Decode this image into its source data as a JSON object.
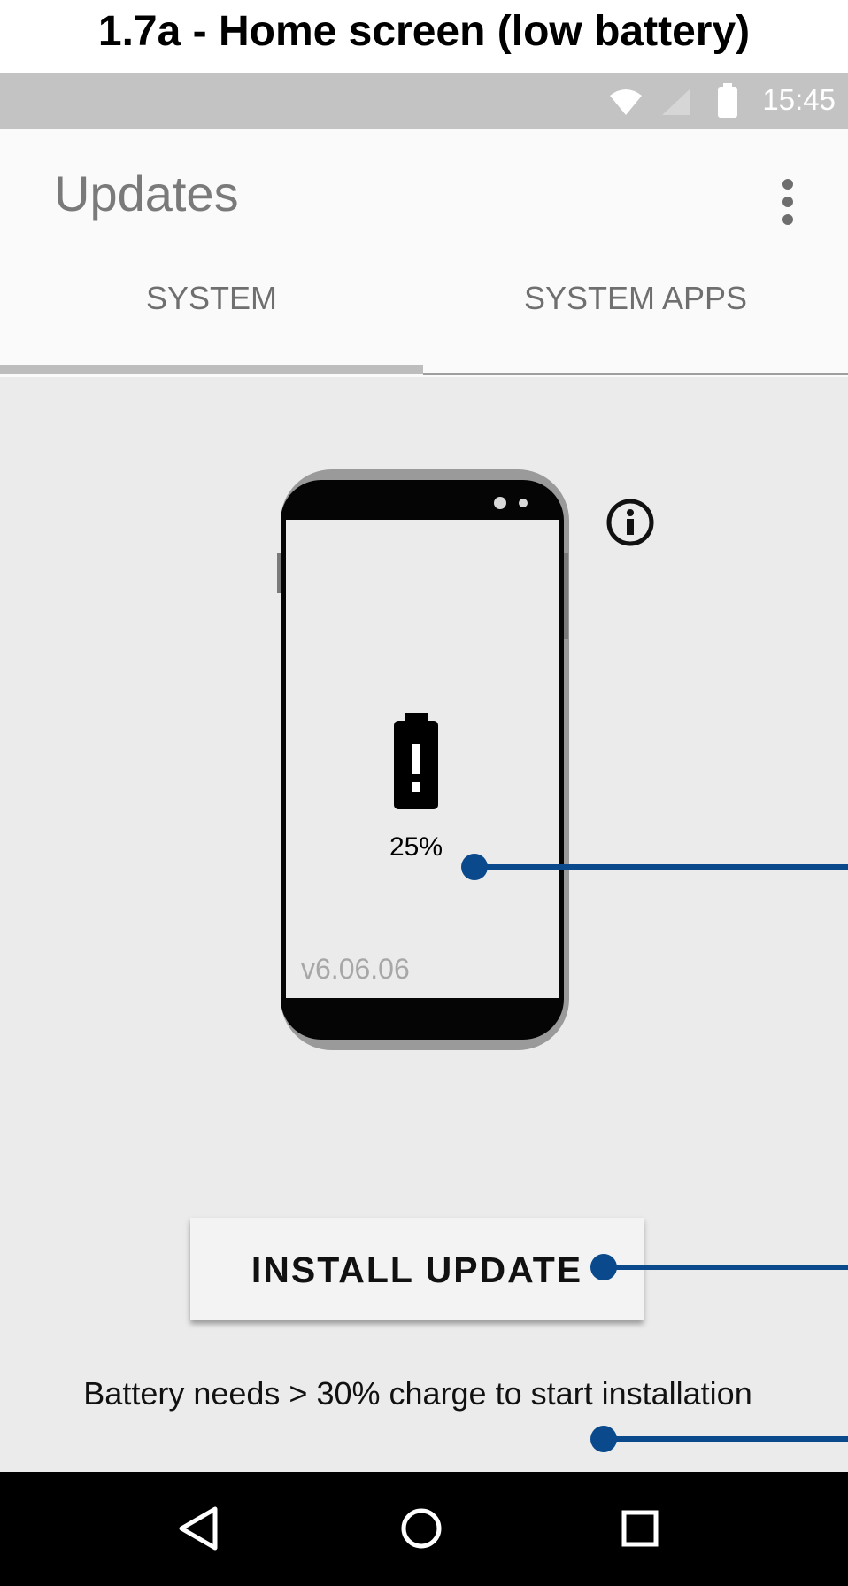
{
  "caption": "1.7a - Home screen (low battery)",
  "status_bar": {
    "time": "15:45",
    "icons": [
      "wifi-icon",
      "cell-signal-icon",
      "battery-icon"
    ]
  },
  "app_bar": {
    "title": "Updates",
    "overflow_icon": "more-vert-icon"
  },
  "tabs": [
    {
      "label": "SYSTEM",
      "selected": true
    },
    {
      "label": "SYSTEM APPS",
      "selected": false
    }
  ],
  "device": {
    "battery_icon": "battery-alert-icon",
    "battery_percent": "25%",
    "version": "v6.06.06"
  },
  "info_icon": "info-icon",
  "install_button": {
    "label": "INSTALL UPDATE"
  },
  "battery_message": "Battery needs > 30% charge to start installation",
  "nav_bar": {
    "icons": [
      "back-icon",
      "home-icon",
      "recents-icon"
    ]
  },
  "colors": {
    "annotation": "#0a4a8c",
    "status_bar": "#c3c3c3",
    "content_bg": "#ebebeb"
  }
}
